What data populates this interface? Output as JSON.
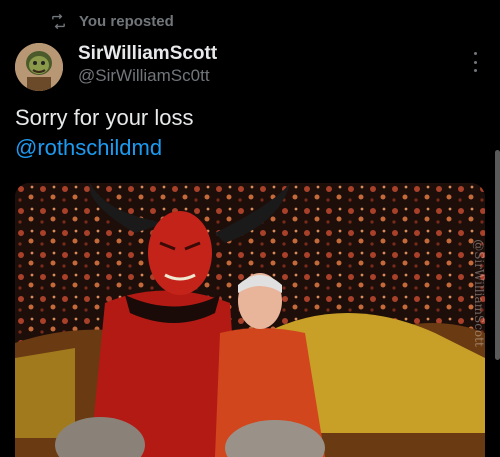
{
  "repost": {
    "label": "You reposted",
    "icon": "repost-icon"
  },
  "author": {
    "display_name": "SirWilliamScott",
    "handle": "@SirWilliamSc0tt",
    "avatar": "avatar-image"
  },
  "tweet": {
    "text": "Sorry for your loss",
    "mention": "@rothschildmd"
  },
  "media": {
    "watermark": "@SirWilliamScott"
  },
  "colors": {
    "background": "#000000",
    "text": "#e7e9ea",
    "secondary": "#71767b",
    "link": "#1d9bf0"
  }
}
